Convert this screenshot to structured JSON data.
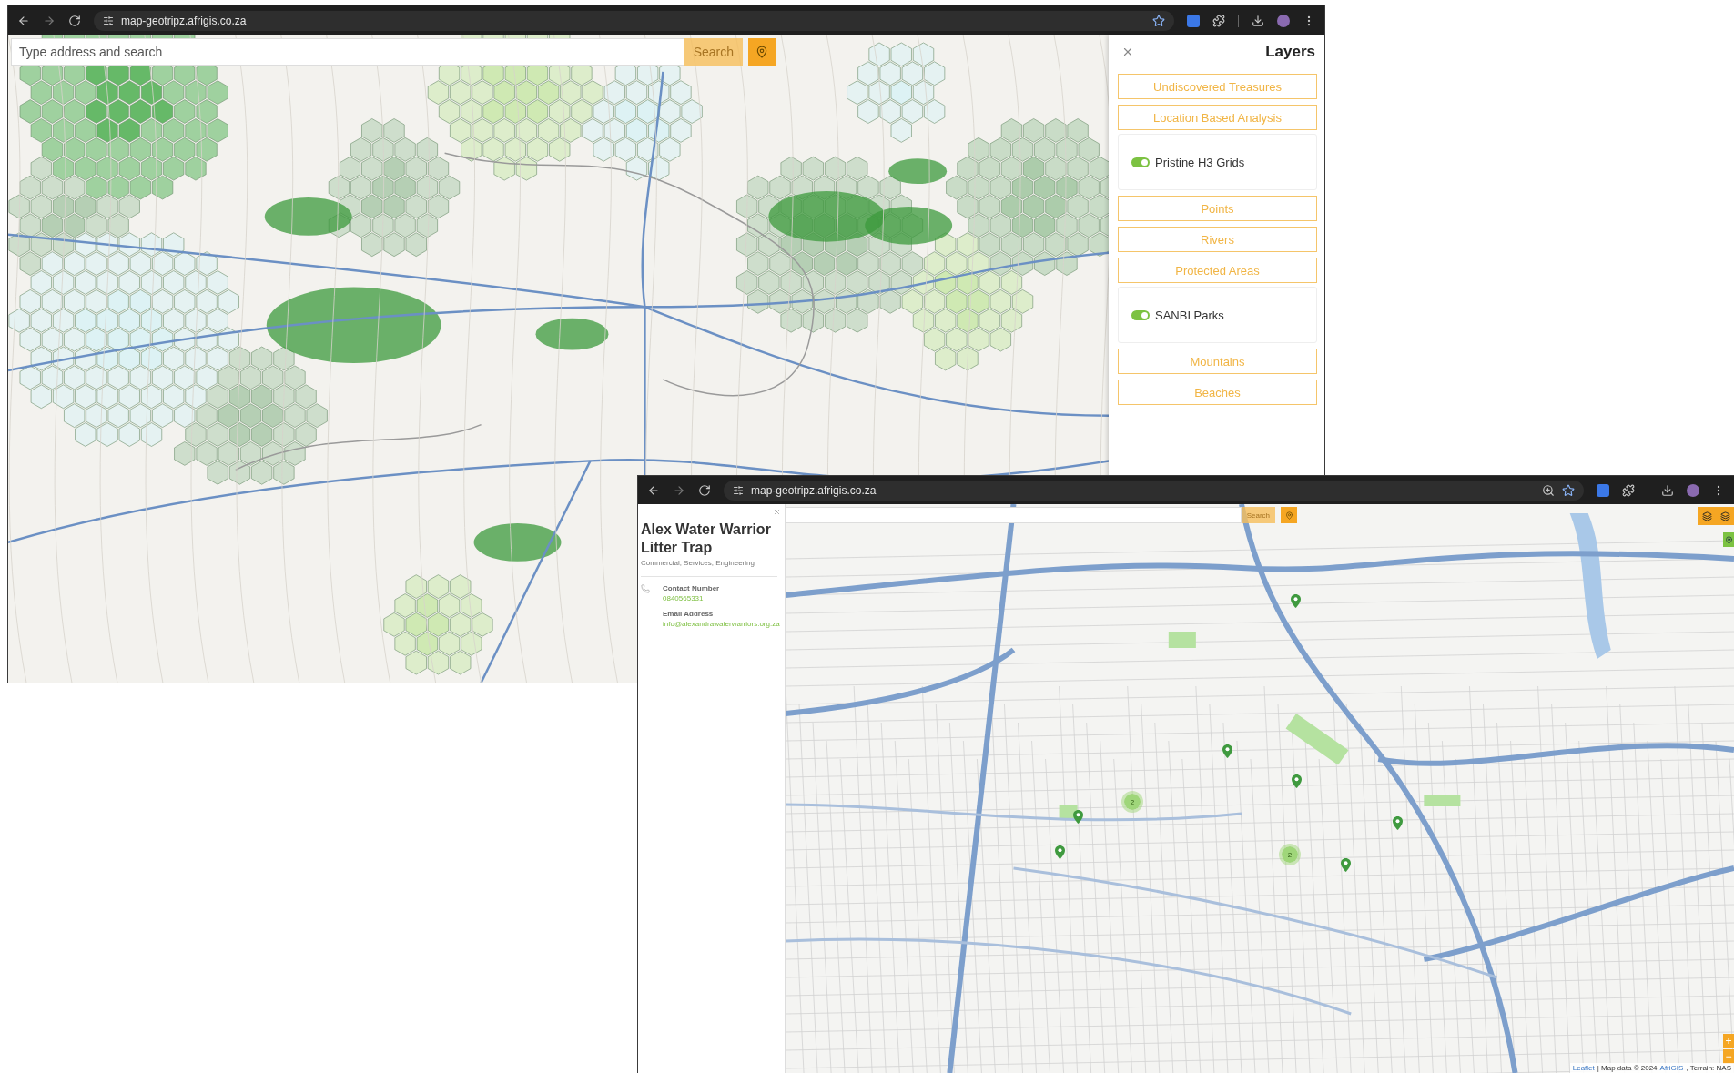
{
  "window_1": {
    "browser": {
      "address": "map-geotripz.afrigis.co.za",
      "zoomed": false
    },
    "search": {
      "placeholder": "Type address and search",
      "button": "Search"
    },
    "layers_panel": {
      "title": "Layers",
      "items": [
        {
          "kind": "section",
          "label": "Undiscovered Treasures"
        },
        {
          "kind": "section",
          "label": "Location Based Analysis"
        },
        {
          "kind": "toggle",
          "label": "Pristine H3 Grids",
          "on": true
        },
        {
          "kind": "section",
          "label": "Points"
        },
        {
          "kind": "section",
          "label": "Rivers"
        },
        {
          "kind": "section",
          "label": "Protected Areas"
        },
        {
          "kind": "toggle",
          "label": "SANBI Parks",
          "on": true
        },
        {
          "kind": "section",
          "label": "Mountains"
        },
        {
          "kind": "section",
          "label": "Beaches"
        }
      ]
    }
  },
  "window_2": {
    "browser": {
      "address": "map-geotripz.afrigis.co.za",
      "zoomed": true
    },
    "search": {
      "button": "Search"
    },
    "detail_panel": {
      "title": "Alex Water Warrior Litter Trap",
      "subtitle": "Commercial, Services, Engineering",
      "fields": [
        {
          "label": "Contact Number",
          "value": "0840565331"
        },
        {
          "label": "Email Address",
          "value": "info@alexandrawaterwarriors.org.za"
        }
      ]
    },
    "markers": [
      {
        "kind": "pin"
      },
      {
        "kind": "pin"
      },
      {
        "kind": "pin"
      },
      {
        "kind": "pin"
      },
      {
        "kind": "pin"
      },
      {
        "kind": "pin"
      },
      {
        "kind": "pin"
      },
      {
        "kind": "cluster",
        "count": "2"
      },
      {
        "kind": "cluster",
        "count": "2"
      }
    ],
    "zoom_buttons": [
      "+",
      "−"
    ],
    "attribution": {
      "link": "Leaflet",
      "text": "| Map data © 2024",
      "source": "AfriGIS",
      "rest": ", Terrain: NAS"
    }
  }
}
